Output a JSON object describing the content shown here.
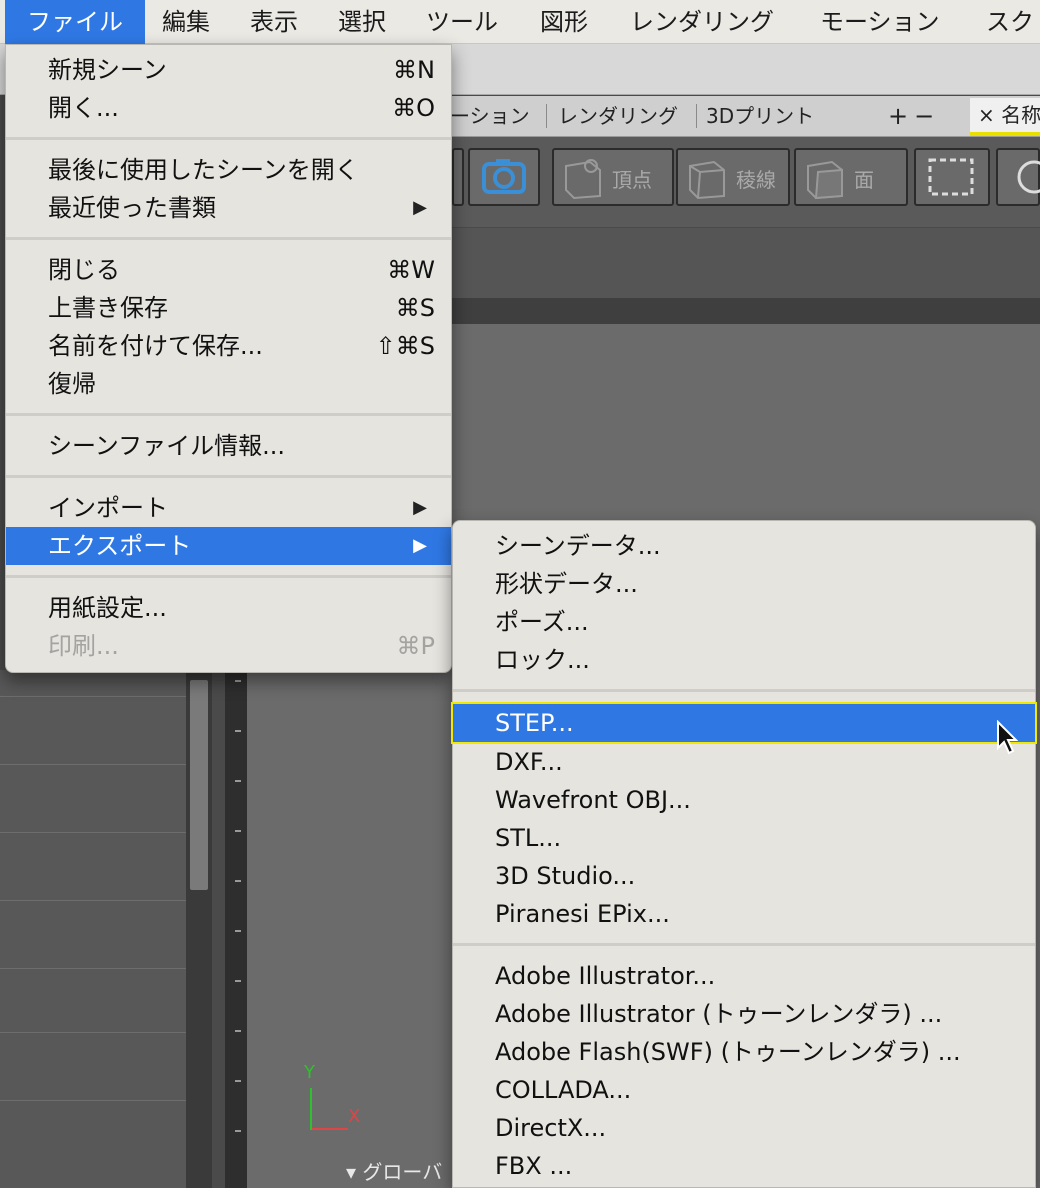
{
  "menubar": {
    "items": [
      "ファイル",
      "編集",
      "表示",
      "選択",
      "ツール",
      "図形",
      "レンダリング",
      "モーション",
      "スク"
    ]
  },
  "tabs": {
    "items": [
      "ーション",
      "レンダリング",
      "3Dプリント"
    ],
    "plus_minus": "+−",
    "active_label": "× 名称"
  },
  "toolbar": {
    "vertex_label": "頂点",
    "edge_label": "稜線",
    "face_label": "面"
  },
  "viewport": {
    "axis_y": "Y",
    "axis_x": "X",
    "global_label": "グローバ"
  },
  "file_menu": {
    "new_scene": {
      "label": "新規シーン",
      "shortcut": "⌘N"
    },
    "open": {
      "label": "開く...",
      "shortcut": "⌘O"
    },
    "open_last": {
      "label": "最後に使用したシーンを開く"
    },
    "recent": {
      "label": "最近使った書類"
    },
    "close": {
      "label": "閉じる",
      "shortcut": "⌘W"
    },
    "save": {
      "label": "上書き保存",
      "shortcut": "⌘S"
    },
    "save_as": {
      "label": "名前を付けて保存...",
      "shortcut": "⇧⌘S"
    },
    "revert": {
      "label": "復帰"
    },
    "scene_info": {
      "label": "シーンファイル情報..."
    },
    "import": {
      "label": "インポート"
    },
    "export": {
      "label": "エクスポート"
    },
    "page_setup": {
      "label": "用紙設定..."
    },
    "print": {
      "label": "印刷...",
      "shortcut": "⌘P"
    },
    "submenu_arrow": "▶"
  },
  "export_menu": {
    "items": [
      "シーンデータ...",
      "形状データ...",
      "ポーズ...",
      "ロック...",
      "STEP...",
      "DXF...",
      "Wavefront OBJ...",
      "STL...",
      "3D Studio...",
      "Piranesi EPix...",
      "Adobe Illustrator...",
      "Adobe Illustrator (トゥーンレンダラ) ...",
      "Adobe Flash(SWF) (トゥーンレンダラ) ...",
      "COLLADA...",
      "DirectX...",
      "FBX ..."
    ],
    "highlighted": "STEP..."
  },
  "colors": {
    "highlight": "#2f78e4",
    "focus_outline": "#f0e800"
  }
}
